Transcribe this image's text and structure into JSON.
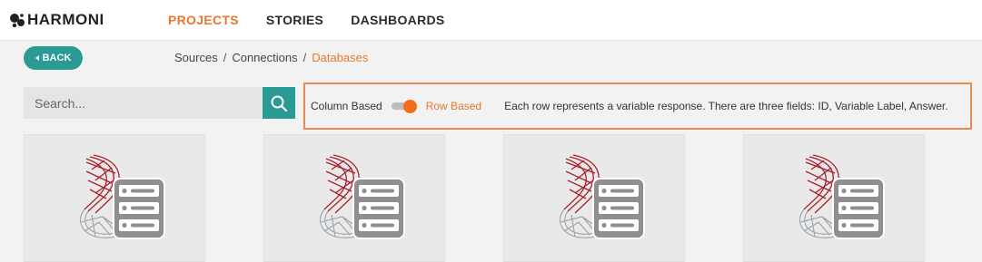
{
  "brand": {
    "name": "HARMONI",
    "icon": "harmoni-logo-icon"
  },
  "nav": {
    "items": [
      {
        "label": "PROJECTS",
        "active": true
      },
      {
        "label": "STORIES",
        "active": false
      },
      {
        "label": "DASHBOARDS",
        "active": false
      }
    ]
  },
  "back_button": {
    "label": "BACK",
    "icon": "chevron-left-icon"
  },
  "breadcrumb": {
    "items": [
      "Sources",
      "Connections",
      "Databases"
    ],
    "separator": "/"
  },
  "search": {
    "placeholder": "Search...",
    "value": "",
    "icon": "search-icon"
  },
  "mode_switch": {
    "off_label": "Column Based",
    "on_label": "Row Based",
    "selected": "Row Based",
    "description": "Each row represents a variable response. There are three fields: ID, Variable Label, Answer."
  },
  "cards": [
    {
      "icon": "sql-server-database-icon"
    },
    {
      "icon": "sql-server-database-icon"
    },
    {
      "icon": "sql-server-database-icon"
    },
    {
      "icon": "sql-server-database-icon"
    }
  ],
  "colors": {
    "accent": "#e8772e",
    "teal": "#2a9a95",
    "toggle_knob": "#f36d17",
    "highlight_border": "#e88a52",
    "sql_red": "#a7212b"
  }
}
